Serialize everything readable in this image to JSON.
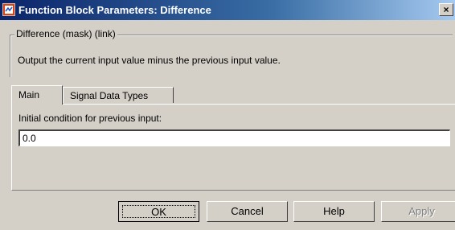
{
  "window": {
    "title": "Function Block Parameters: Difference",
    "close_label": "×",
    "icon": "simulink-block-icon"
  },
  "mask": {
    "group_title": "Difference (mask) (link)",
    "description": "Output the current input value minus the previous input value."
  },
  "tabs": [
    {
      "label": "Main",
      "active": true
    },
    {
      "label": "Signal Data Types",
      "active": false
    }
  ],
  "main": {
    "initial_condition_label": "Initial condition for previous input:",
    "initial_condition_value": "0.0"
  },
  "buttons": {
    "ok": "OK",
    "cancel": "Cancel",
    "help": "Help",
    "apply": "Apply"
  }
}
